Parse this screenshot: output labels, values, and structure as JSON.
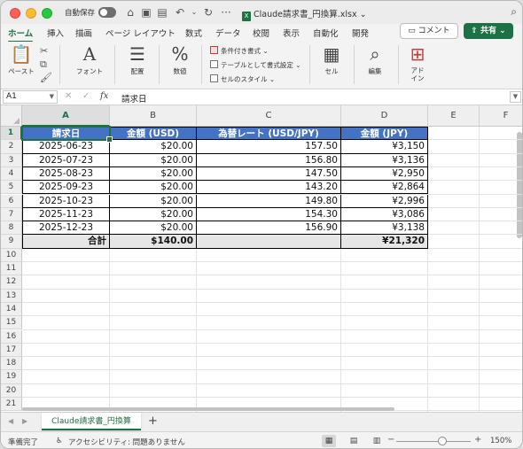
{
  "titlebar": {
    "autosave_label": "自動保存",
    "doc_title": "Claude請求書_円換算.xlsx",
    "doc_title_chevron": "⌄",
    "file_badge": "X"
  },
  "ribbon_tabs": [
    "ホーム",
    "挿入",
    "描画",
    "ページ レイアウト",
    "数式",
    "データ",
    "校閲",
    "表示",
    "自動化",
    "開発"
  ],
  "actions": {
    "comment_label": "コメント",
    "share_label": "共有"
  },
  "ribbon": {
    "paste_label": "ペースト",
    "font_label": "フォント",
    "alignment_label": "配置",
    "number_label": "数値",
    "conditional_format_label": "条件付き書式",
    "format_as_table_label": "テーブルとして書式設定",
    "cell_styles_label": "セルのスタイル",
    "cells_label": "セル",
    "editing_label": "編集",
    "addins_label": "アド\nイン"
  },
  "formula_bar": {
    "name_box": "A1",
    "fx_label": "fx",
    "value": "請求日"
  },
  "columns": [
    "A",
    "B",
    "C",
    "D",
    "E",
    "F"
  ],
  "rows": [
    "1",
    "2",
    "3",
    "4",
    "5",
    "6",
    "7",
    "8",
    "9",
    "10",
    "11",
    "12",
    "13",
    "14",
    "15",
    "16",
    "17",
    "18",
    "19",
    "20",
    "21"
  ],
  "table": {
    "headers": [
      "請求日",
      "金額 (USD)",
      "為替レート (USD/JPY)",
      "金額 (JPY)"
    ],
    "rows": [
      [
        "2025-06-23",
        "$20.00",
        "157.50",
        "¥3,150"
      ],
      [
        "2025-07-23",
        "$20.00",
        "156.80",
        "¥3,136"
      ],
      [
        "2025-08-23",
        "$20.00",
        "147.50",
        "¥2,950"
      ],
      [
        "2025-09-23",
        "$20.00",
        "143.20",
        "¥2,864"
      ],
      [
        "2025-10-23",
        "$20.00",
        "149.80",
        "¥2,996"
      ],
      [
        "2025-11-23",
        "$20.00",
        "154.30",
        "¥3,086"
      ],
      [
        "2025-12-23",
        "$20.00",
        "156.90",
        "¥3,138"
      ]
    ],
    "total": [
      "合計",
      "$140.00",
      "",
      "¥21,320"
    ]
  },
  "sheet_tabs": {
    "active_sheet": "Claude請求書_円換算",
    "add_sheet": "+"
  },
  "statusbar": {
    "ready": "準備完了",
    "accessibility": "アクセシビリティ: 問題ありません",
    "zoom_minus": "−",
    "zoom_plus": "+",
    "zoom": "150%"
  },
  "colors": {
    "header_fill": "#4472c4",
    "total_fill": "#e7e6e6",
    "accent": "#1e7145"
  },
  "icons": [
    "home-icon",
    "save-icon",
    "undo-icon",
    "redo-icon",
    "search-icon",
    "paste-icon",
    "cut-icon",
    "copy-icon",
    "format-painter-icon",
    "font-icon",
    "align-icon",
    "percent-icon",
    "cells-icon",
    "find-icon",
    "addins-icon"
  ]
}
